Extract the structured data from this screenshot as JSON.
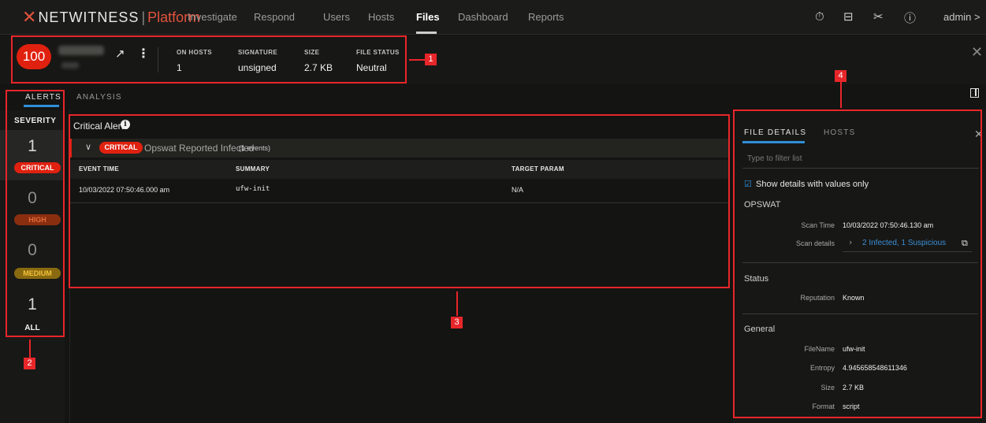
{
  "nav": {
    "logo_text": "NETWITNESS",
    "logo_sep": "|",
    "logo_platform": "Platform",
    "items": [
      "Investigate",
      "Respond",
      "Users",
      "Hosts",
      "Files",
      "Dashboard",
      "Reports"
    ],
    "active_item": "Files",
    "user": "admin >",
    "icons": [
      "stopwatch-icon",
      "settings-panel-icon",
      "tools-icon",
      "help-icon"
    ],
    "icon_glyphs": [
      "⏱",
      "⊟",
      "✂",
      "ⓘ"
    ]
  },
  "file": {
    "risk_score": "100",
    "meta": [
      {
        "label": "ON HOSTS",
        "value": "1"
      },
      {
        "label": "SIGNATURE",
        "value": "unsigned"
      },
      {
        "label": "SIZE",
        "value": "2.7 KB"
      },
      {
        "label": "FILE STATUS",
        "value": "Neutral"
      }
    ]
  },
  "tabs": [
    "ALERTS",
    "ANALYSIS"
  ],
  "severity": {
    "title": "SEVERITY",
    "levels": [
      {
        "count": "1",
        "label": "CRITICAL",
        "color": "#e0210f",
        "text_color": "#ffffff"
      },
      {
        "count": "0",
        "label": "HIGH",
        "color": "#8a2e10",
        "text_color": "#e06a3a"
      },
      {
        "count": "0",
        "label": "MEDIUM",
        "color": "#8a6a10",
        "text_color": "#f2c23a"
      },
      {
        "count": "1",
        "label": "ALL",
        "color": "",
        "text_color": "#f0f0f0"
      }
    ]
  },
  "alerts": {
    "title": "Critical Alerts",
    "info_glyph": "i",
    "group": {
      "chevron": "∨",
      "badge": "CRITICAL",
      "name": "Opswat Reported Infected",
      "count": "(1 events)"
    },
    "columns": [
      "EVENT TIME",
      "SUMMARY",
      "TARGET PARAM"
    ],
    "rows": [
      {
        "event_time": "10/03/2022 07:50:46.000 am",
        "summary": "ufw-init",
        "target_param": "N/A"
      }
    ]
  },
  "details": {
    "tabs": [
      "FILE DETAILS",
      "HOSTS"
    ],
    "filter_placeholder": "Type to filter list",
    "show_values_only": "Show details with values only",
    "sections": {
      "opswat": {
        "title": "OPSWAT",
        "scan_time_label": "Scan Time",
        "scan_time": "10/03/2022 07:50:46.130 am",
        "scan_details_label": "Scan details",
        "scan_details": "2 Infected, 1 Suspicious"
      },
      "status": {
        "title": "Status",
        "reputation_label": "Reputation",
        "reputation": "Known"
      },
      "general": {
        "title": "General",
        "items": [
          {
            "key": "FileName",
            "value": "ufw-init"
          },
          {
            "key": "Entropy",
            "value": "4.945658548611346"
          },
          {
            "key": "Size",
            "value": "2.7 KB"
          },
          {
            "key": "Format",
            "value": "script"
          }
        ]
      }
    }
  },
  "annotations": [
    "1",
    "2",
    "3",
    "4"
  ],
  "accent": "#2f8fd8",
  "annotation_color": "#e8262a"
}
